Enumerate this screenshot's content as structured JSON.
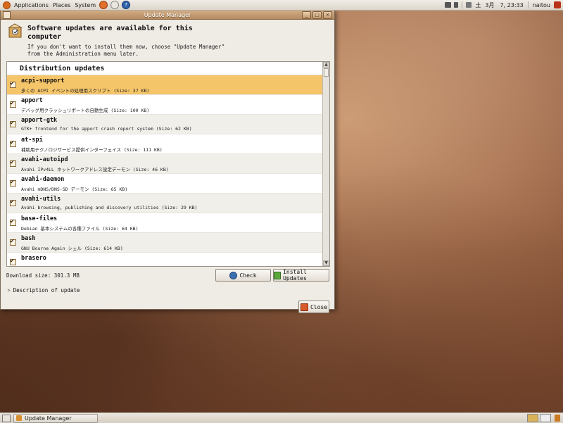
{
  "top_panel": {
    "menus": [
      "Applications",
      "Places",
      "System"
    ],
    "clock": "3月　7, 23:33",
    "keyboard_indicator": "土",
    "username": "naitou"
  },
  "window": {
    "title": "Update Manager",
    "header_title": "Software updates are available for this computer",
    "header_desc": "If you don't want to install them now, choose \"Update Manager\" from the Administration menu later.",
    "group_label": "Distribution updates",
    "packages": [
      {
        "name": "acpi-support",
        "desc": "多くの ACPI イベントの処理用スクリプト (Size: 37 KB)",
        "checked": true,
        "selected": true
      },
      {
        "name": "apport",
        "desc": "デバッグ用クラッシュリポートの自動生成 (Size: 100 KB)",
        "checked": true
      },
      {
        "name": "apport-gtk",
        "desc": "GTK+ frontend for the apport crash report system (Size: 62 KB)",
        "checked": true
      },
      {
        "name": "at-spi",
        "desc": "補助用テクノロジサービス提供インターフェイス (Size: 111 KB)",
        "checked": true
      },
      {
        "name": "avahi-autoipd",
        "desc": "Avahi IPv4LL ネットワークアドレス設定デーモン (Size: 46 KB)",
        "checked": true
      },
      {
        "name": "avahi-daemon",
        "desc": "Avahi mDNS/DNS-SD デーモン (Size: 65 KB)",
        "checked": true
      },
      {
        "name": "avahi-utils",
        "desc": "Avahi browsing, publishing and discovery utilities (Size: 29 KB)",
        "checked": true
      },
      {
        "name": "base-files",
        "desc": "Debian 基本システムの各種ファイル (Size: 64 KB)",
        "checked": true
      },
      {
        "name": "bash",
        "desc": "GNU Bourne Again シェル (Size: 614 KB)",
        "checked": true
      },
      {
        "name": "brasero",
        "desc": "",
        "checked": true
      }
    ],
    "download_size": "Download size: 301.3 MB",
    "check_label": "Check",
    "install_label": "Install Updates",
    "description_label": "Description of update",
    "close_label": "Close"
  },
  "taskbar": {
    "task_label": "Update Manager"
  },
  "colors": {
    "selected_row": "#f5c56a",
    "titlebar": "#c49a6e",
    "desktop": "#a87150"
  }
}
